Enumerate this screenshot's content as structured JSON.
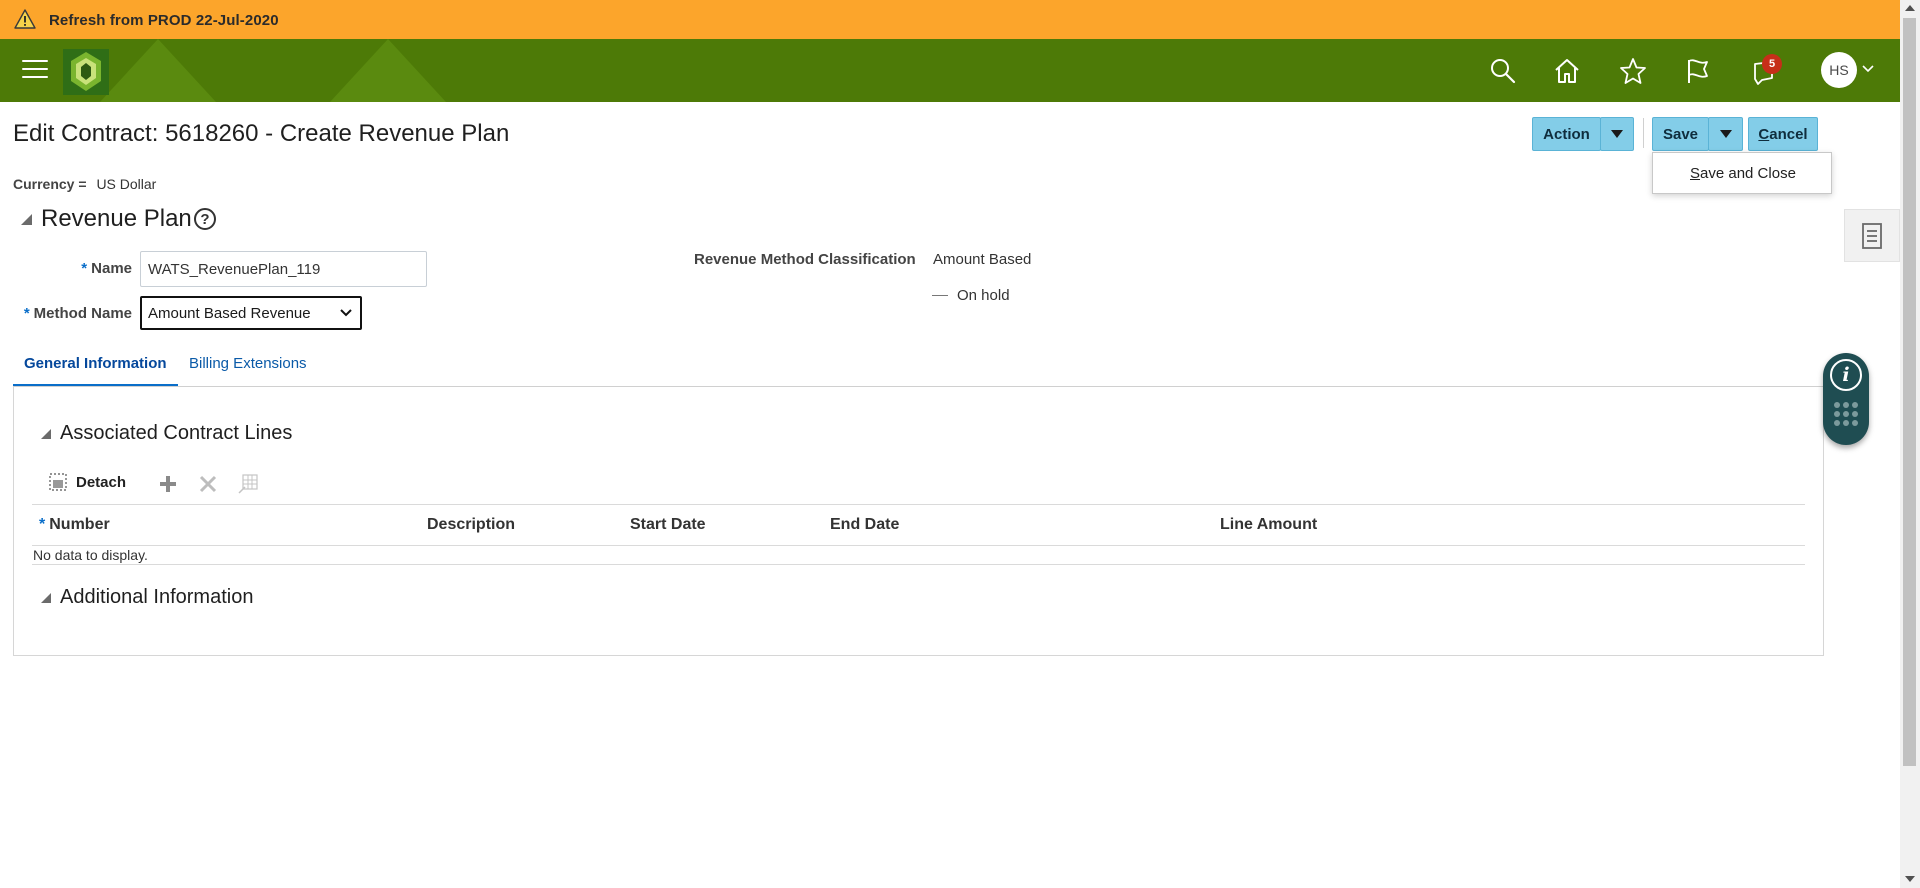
{
  "banner": {
    "text": "Refresh from PROD 22-Jul-2020",
    "color": "#fca52b",
    "icon": "warning-icon"
  },
  "header": {
    "color": "#4d7a07",
    "icons": [
      "menu-icon",
      "search-icon",
      "home-icon",
      "favorites-star-icon",
      "flag-icon",
      "notifications-icon"
    ],
    "notification_count": "5",
    "user_initials": "HS"
  },
  "page": {
    "title": "Edit Contract: 5618260 - Create Revenue Plan",
    "currency_label": "Currency =",
    "currency_value": "US Dollar"
  },
  "buttons": {
    "action_label": "Action",
    "save_label": "Save",
    "cancel_label": "Cancel",
    "accent": "#83cde8"
  },
  "save_menu": {
    "items": [
      "Save and Close"
    ]
  },
  "revenue_plan": {
    "section_title": "Revenue Plan",
    "name_label": "Name",
    "name_value": "WATS_RevenuePlan_119",
    "method_label": "Method Name",
    "method_value": "Amount Based Revenue",
    "classification_label": "Revenue Method Classification",
    "classification_value": "Amount Based",
    "status_text": "On hold"
  },
  "tabs": [
    {
      "label": "General Information",
      "active": true
    },
    {
      "label": "Billing Extensions",
      "active": false
    }
  ],
  "associated_lines": {
    "section_title": "Associated Contract Lines",
    "detach_label": "Detach",
    "columns": [
      "Number",
      "Description",
      "Start Date",
      "End Date",
      "Line Amount"
    ],
    "empty_text": "No data to display."
  },
  "additional_info": {
    "section_title": "Additional Information"
  }
}
